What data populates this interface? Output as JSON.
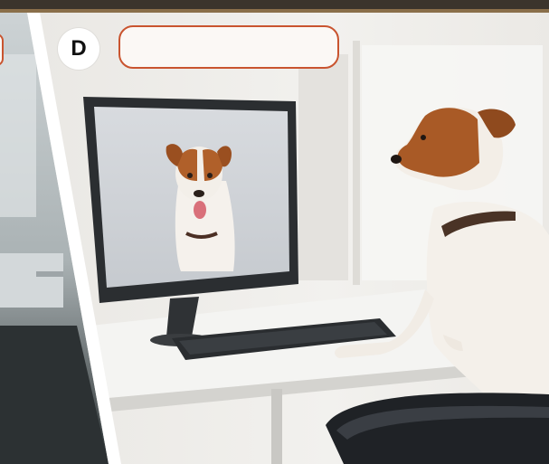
{
  "panel": {
    "label": "D",
    "answer_value": ""
  },
  "colors": {
    "accent": "#c9542f",
    "box_fill": "#fbf8f5"
  }
}
